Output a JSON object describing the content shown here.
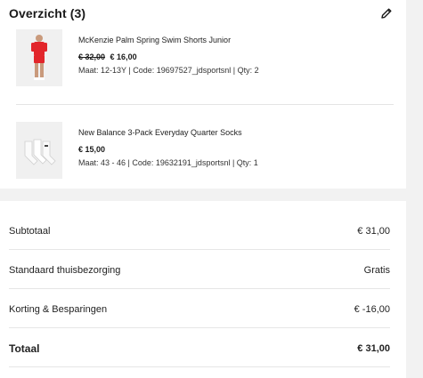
{
  "overview": {
    "title": "Overzicht (3)",
    "edit_icon": "pencil-icon"
  },
  "items": [
    {
      "name": "McKenzie Palm Spring Swim Shorts Junior",
      "price_old": "€ 32,00",
      "price": "€ 16,00",
      "meta": "Maat: 12-13Y | Code: 19697527_jdsportsnl | Qty: 2"
    },
    {
      "name": "New Balance 3-Pack Everyday Quarter Socks",
      "price_old": "",
      "price": "€ 15,00",
      "meta": "Maat: 43 - 46 | Code: 19632191_jdsportsnl | Qty: 1"
    }
  ],
  "summary": {
    "subtotal_label": "Subtotaal",
    "subtotal_value": "€ 31,00",
    "shipping_label": "Standaard thuisbezorging",
    "shipping_value": "Gratis",
    "discount_label": "Korting & Besparingen",
    "discount_value": "€ -16,00",
    "total_label": "Totaal",
    "total_value": "€ 31,00"
  },
  "colors": {
    "background": "#f2f2f2",
    "card": "#ffffff",
    "shorts_red": "#e2262b"
  }
}
